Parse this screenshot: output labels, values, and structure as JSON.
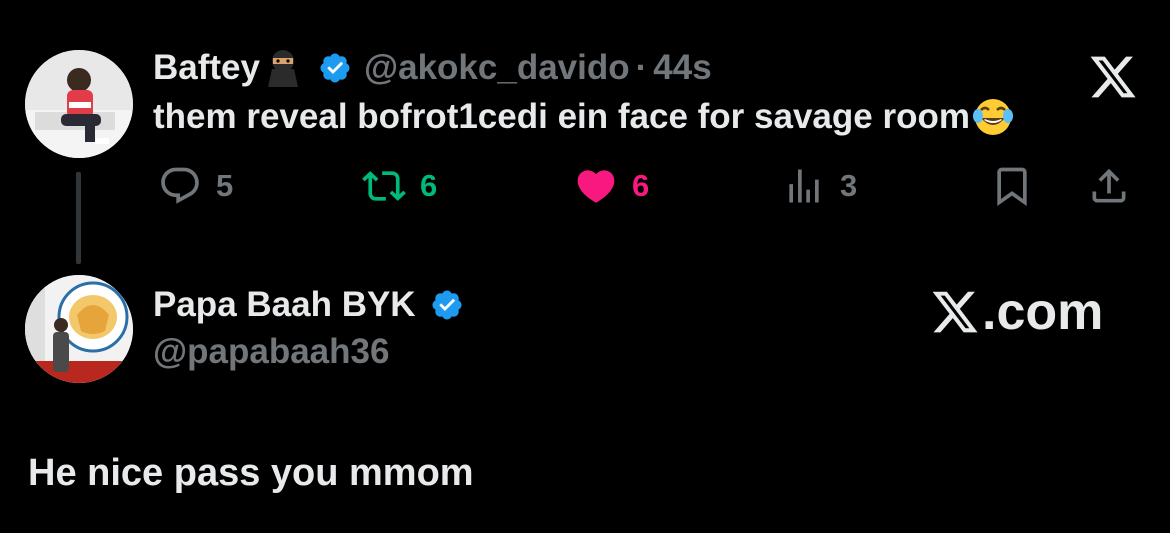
{
  "tweet": {
    "author_name": "Baftey",
    "author_emoji": "ninja-emoji",
    "verified": true,
    "handle": "@akokc_davido",
    "separator": "·",
    "time": "44s",
    "text": "them reveal bofrot1cedi ein face for savage room",
    "text_emoji": "face-with-tears-of-joy-emoji",
    "actions": {
      "replies": "5",
      "reposts": "6",
      "likes": "6",
      "views": "3"
    }
  },
  "profile": {
    "name": "Papa Baah BYK",
    "verified": true,
    "handle": "@papabaah36"
  },
  "watermark": {
    "icon": "x-logo",
    "text": ".com"
  },
  "reply": {
    "text": "He nice pass you mmom"
  },
  "colors": {
    "background": "#000000",
    "primary_text": "#e7e9ea",
    "secondary_text": "#71767b",
    "verified_blue": "#1d9bf0",
    "repost_green": "#00ba7c",
    "like_pink": "#f91880"
  },
  "icons": [
    "reply-icon",
    "repost-icon",
    "heart-icon",
    "views-icon",
    "bookmark-icon",
    "share-icon",
    "x-logo-icon",
    "verified-badge-icon"
  ]
}
